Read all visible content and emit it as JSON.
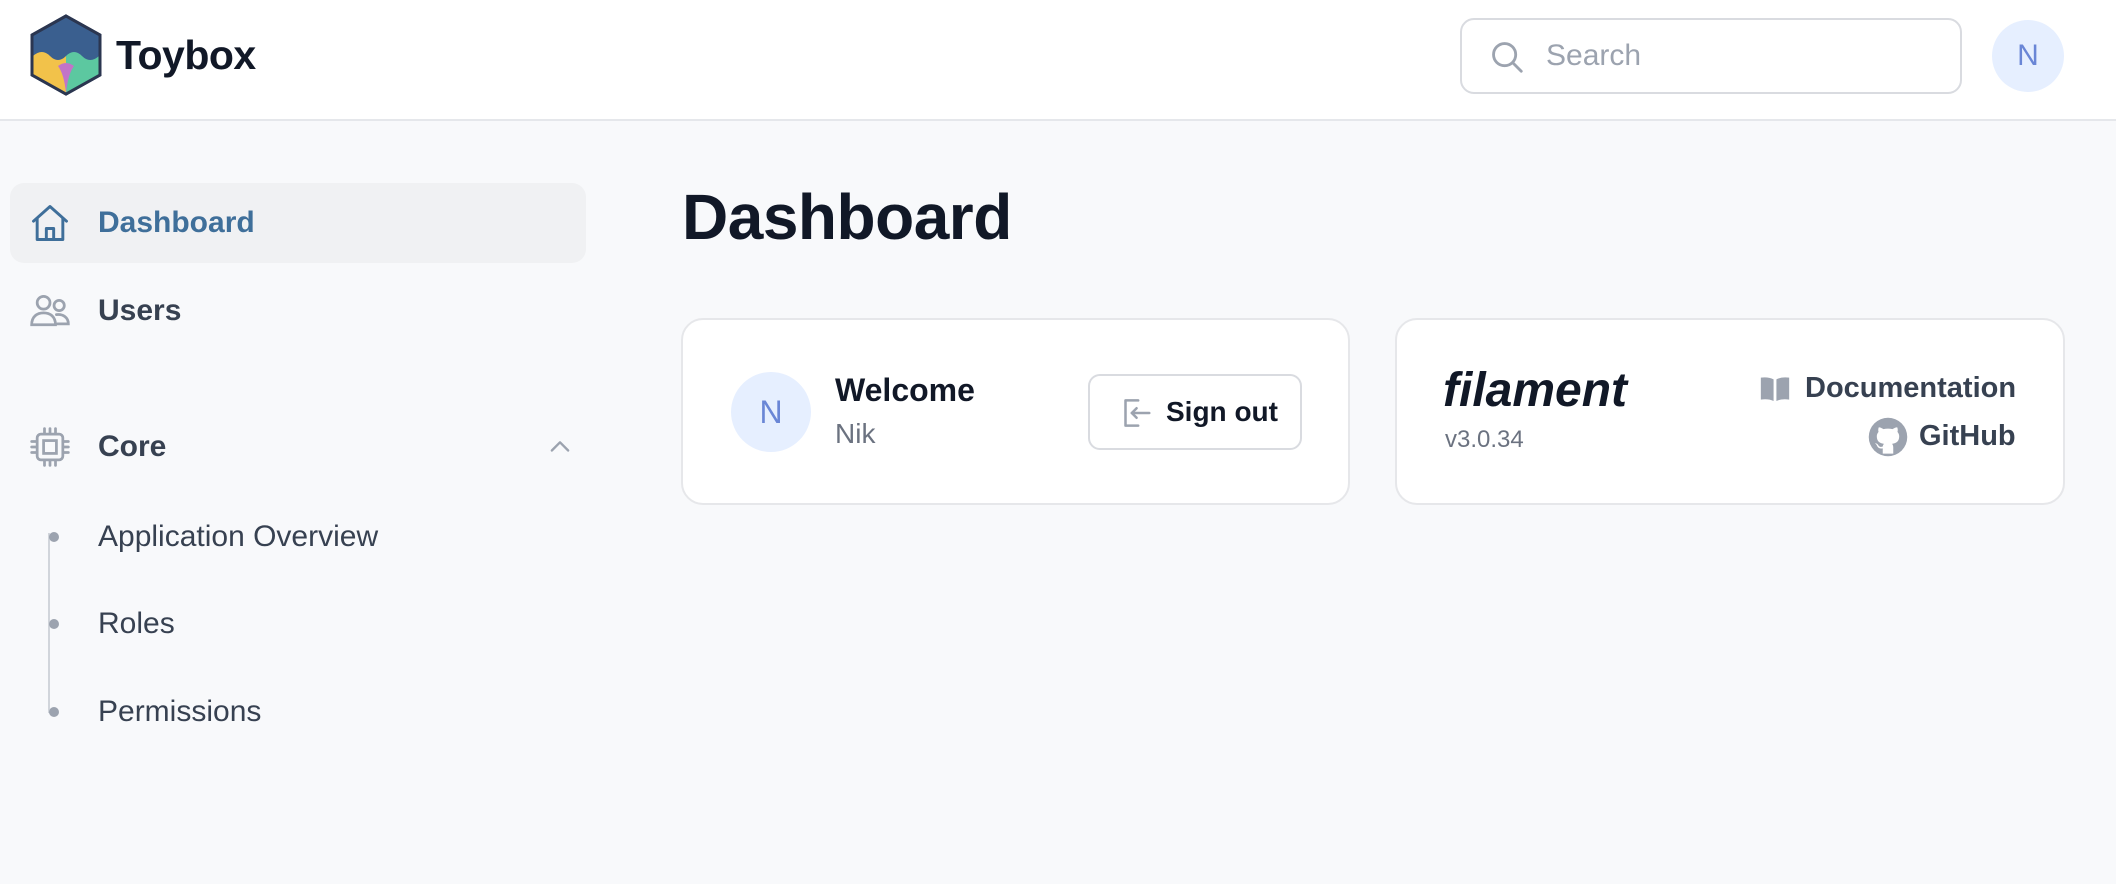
{
  "app": {
    "name": "Toybox"
  },
  "header": {
    "search_placeholder": "Search",
    "user_initial": "N"
  },
  "sidebar": {
    "items": [
      {
        "label": "Dashboard",
        "icon": "home-icon",
        "active": true
      },
      {
        "label": "Users",
        "icon": "users-icon",
        "active": false
      }
    ],
    "group": {
      "label": "Core",
      "icon": "cpu-chip-icon",
      "expanded": true,
      "items": [
        {
          "label": "Application Overview"
        },
        {
          "label": "Roles"
        },
        {
          "label": "Permissions"
        }
      ]
    }
  },
  "main": {
    "title": "Dashboard",
    "welcome_card": {
      "avatar_initial": "N",
      "title": "Welcome",
      "user_name": "Nik",
      "sign_out_label": "Sign out"
    },
    "filament_card": {
      "logo_text": "filament",
      "version": "v3.0.34",
      "documentation_label": "Documentation",
      "github_label": "GitHub"
    }
  },
  "colors": {
    "accent": "#3f6f9a",
    "avatar_bg": "#e6efff",
    "avatar_text": "#6a86d6",
    "background": "#f8f9fb"
  }
}
